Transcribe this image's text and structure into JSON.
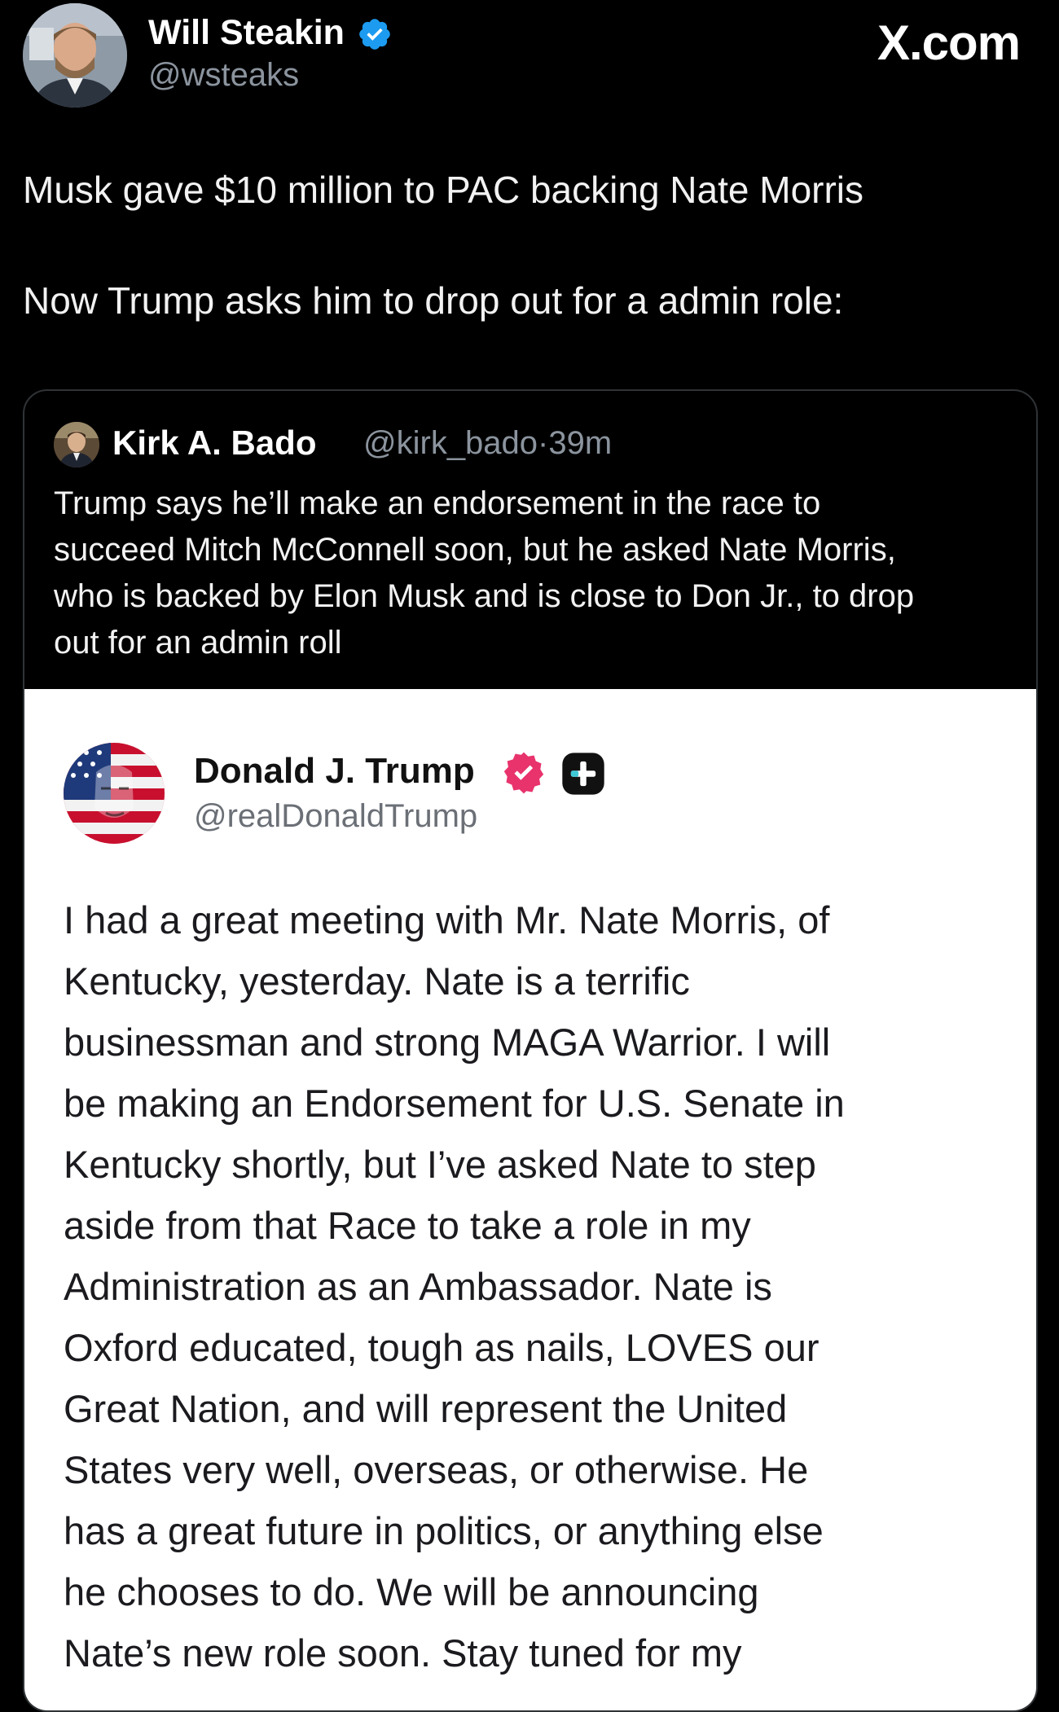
{
  "tweet": {
    "author_name": "Will Steakin",
    "author_handle": "@wsteaks",
    "site_label": "X.com",
    "text_line1": "Musk gave $10 million to PAC backing Nate Morris",
    "text_line2": "Now Trump asks him to drop out for a admin role:"
  },
  "quote": {
    "author_name": "Kirk A. Bado",
    "author_handle": "@kirk_bado",
    "separator": "·",
    "time": "39m",
    "text_lines": [
      "Trump says he’ll make an endorsement in the race to",
      "succeed Mitch McConnell soon, but he asked Nate Morris,",
      "who is backed by Elon Musk and is close to Don Jr., to drop",
      "out for an admin roll"
    ]
  },
  "embed": {
    "author_name": "Donald J. Trump",
    "author_handle": "@realDonaldTrump",
    "body_lines": [
      "I had a great meeting with Mr. Nate Morris, of",
      "Kentucky, yesterday. Nate is a terrific",
      "businessman and strong MAGA Warrior. I will",
      "be making an Endorsement for U.S. Senate in",
      "Kentucky shortly, but I’ve asked Nate to step",
      "aside from that Race to take a role in my",
      "Administration as an Ambassador. Nate is",
      "Oxford educated, tough as nails, LOVES our",
      "Great Nation, and will represent the United",
      "States very well, overseas, or otherwise. He",
      "has a great future in politics, or anything else",
      "he chooses to do. We will be announcing",
      "Nate’s new role soon. Stay tuned for my"
    ]
  },
  "icons": {
    "verified": "verified-badge-icon",
    "pink_badge": "pink-verified-badge-icon",
    "plus_badge": "plus-badge-icon"
  },
  "colors": {
    "background": "#000000",
    "verified_blue": "#1d9bf0",
    "badge_pink": "#e8336d",
    "secondary_text": "#8b949e",
    "card_border": "#2f3336",
    "embed_background": "#ffffff"
  }
}
